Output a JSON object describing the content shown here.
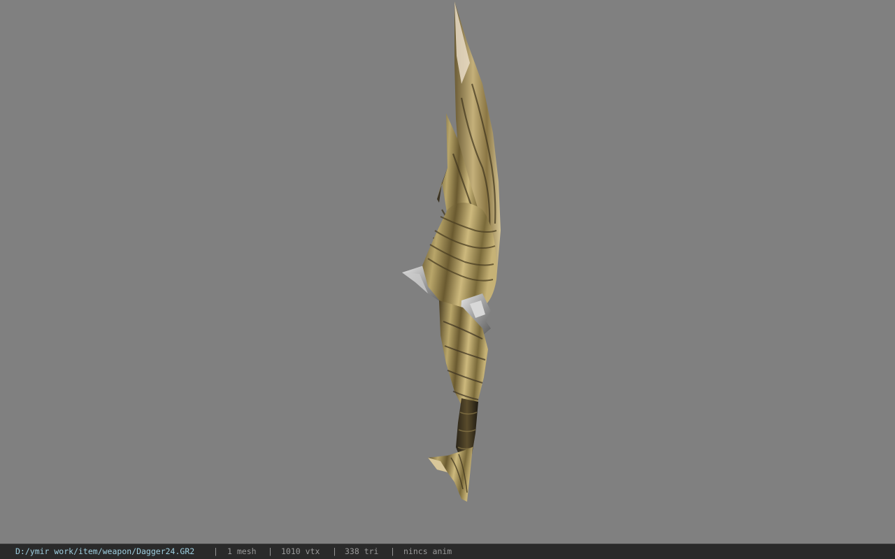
{
  "status_bar": {
    "file_path": "D:/ymir work/item/weapon/Dagger24.GR2",
    "separator": "|",
    "mesh_count": "1 mesh",
    "vertex_count": "1010 vtx",
    "triangle_count": "338 tri",
    "animation": "nincs anim"
  },
  "colors": {
    "viewport_background": "#808080",
    "status_bar_background": "#2a2a2a",
    "path_text": "#9fcfe0",
    "info_text": "#9a9a9a"
  }
}
